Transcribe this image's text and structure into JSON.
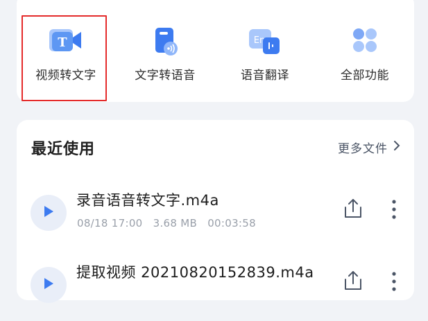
{
  "features": [
    {
      "label": "视频转文字",
      "icon": "video-to-text-icon"
    },
    {
      "label": "文字转语音",
      "icon": "text-to-speech-icon"
    },
    {
      "label": "语音翻译",
      "icon": "voice-translate-icon"
    },
    {
      "label": "全部功能",
      "icon": "all-functions-icon"
    }
  ],
  "recent": {
    "title": "最近使用",
    "more_label": "更多文件",
    "files": [
      {
        "name": "录音语音转文字.m4a",
        "date": "08/18 17:00",
        "size": "3.68 MB",
        "duration": "00:03:58"
      },
      {
        "name": "提取视频 20210820152839.m4a",
        "date": "",
        "size": "",
        "duration": ""
      }
    ]
  },
  "colors": {
    "accent": "#3d7bf0",
    "highlight": "#e42a2a",
    "background": "#f1f3f7"
  }
}
